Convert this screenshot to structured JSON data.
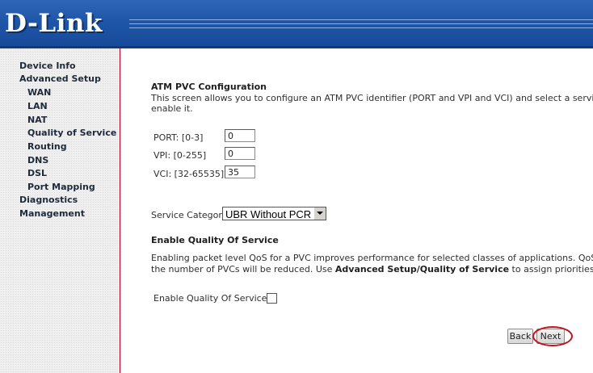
{
  "header": {
    "logo": "D-Link"
  },
  "sidebar": {
    "items": [
      {
        "label": "Device Info"
      },
      {
        "label": "Advanced Setup"
      },
      {
        "label": "WAN"
      },
      {
        "label": "LAN"
      },
      {
        "label": "NAT"
      },
      {
        "label": "Quality of Service"
      },
      {
        "label": "Routing"
      },
      {
        "label": "DNS"
      },
      {
        "label": "DSL"
      },
      {
        "label": "Port Mapping"
      },
      {
        "label": "Diagnostics"
      },
      {
        "label": "Management"
      }
    ]
  },
  "main": {
    "title": "ATM PVC Configuration",
    "description_line1": "This screen allows you to configure an ATM PVC identifier (PORT and VPI and VCI) and select a service cate",
    "description_line2": "enable it.",
    "fields": {
      "port": {
        "label": "PORT: [0-3]",
        "value": "0"
      },
      "vpi": {
        "label": "VPI: [0-255]",
        "value": "0"
      },
      "vci": {
        "label": "VCI: [32-65535]",
        "value": "35"
      }
    },
    "service_category": {
      "label": "Service Category:",
      "value": "UBR Without PCR"
    },
    "qos": {
      "heading": "Enable Quality Of Service",
      "line1": "Enabling packet level QoS for a PVC improves performance for selected classes of applications.  QoS cannot",
      "line2_pre": "the number of PVCs will be reduced. Use ",
      "line2_bold": "Advanced Setup/Quality of Service",
      "line2_post": " to assign priorities for the",
      "checkbox_label": "Enable Quality Of Service",
      "checked": false
    },
    "buttons": {
      "back": "Back",
      "next": "Next"
    },
    "highlight_color": "#c4141d"
  }
}
